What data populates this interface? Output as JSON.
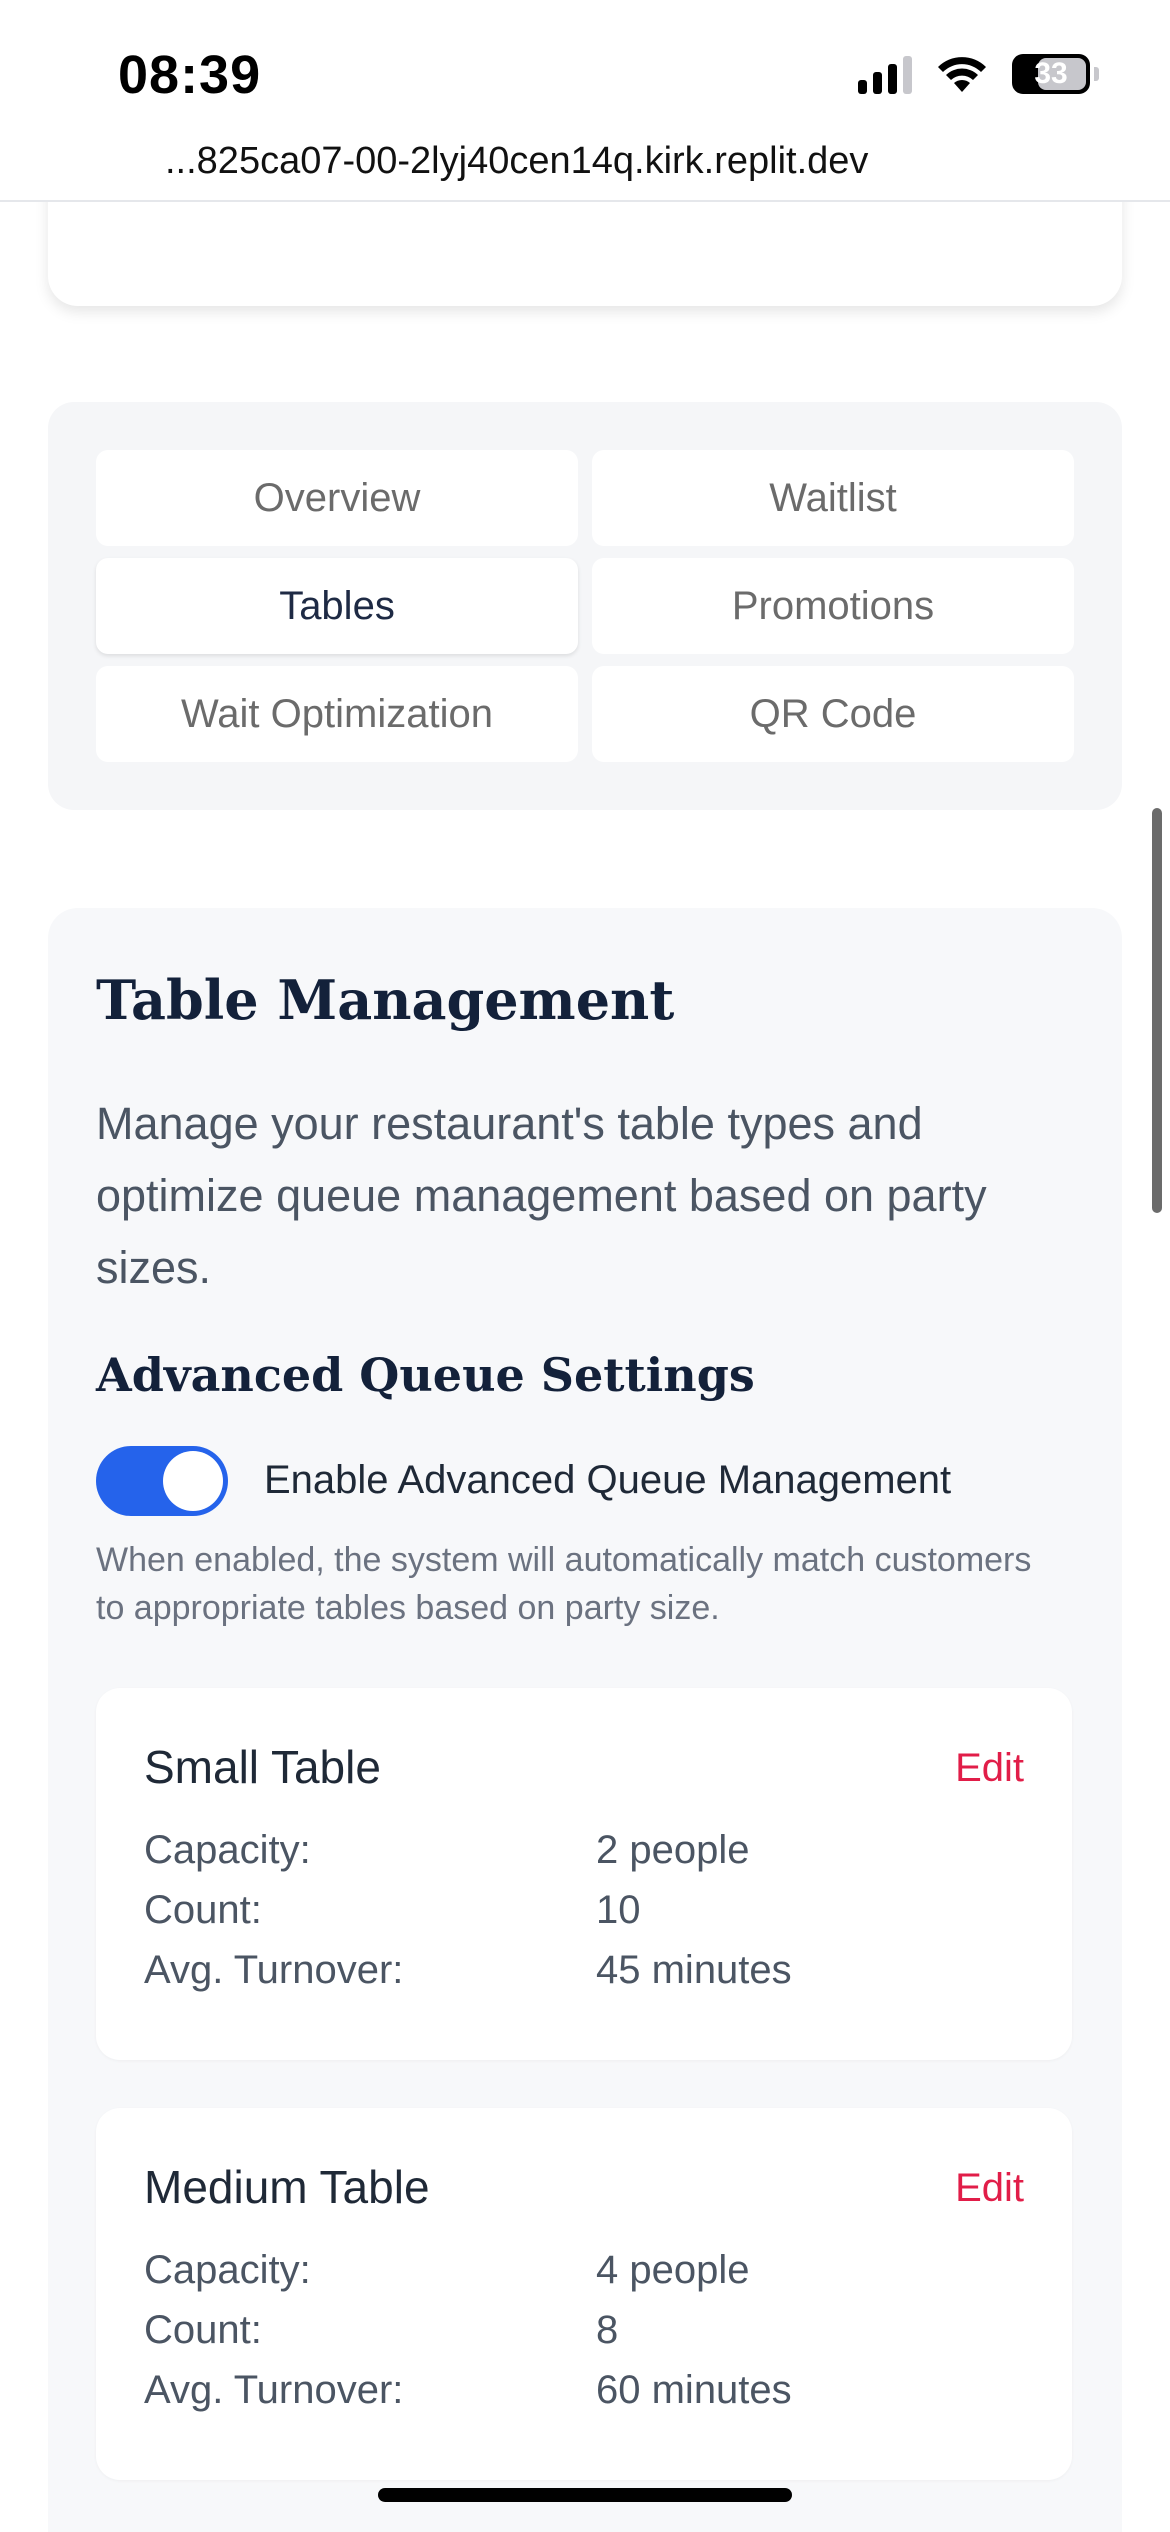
{
  "status_bar": {
    "time": "08:39",
    "battery": "33",
    "signal_icon": "cellular-signal-icon",
    "wifi_icon": "wifi-icon",
    "battery_icon": "battery-icon"
  },
  "browser": {
    "url": "...825ca07-00-2lyj40cen14q.kirk.replit.dev"
  },
  "tabs": [
    {
      "label": "Overview",
      "active": false
    },
    {
      "label": "Waitlist",
      "active": false
    },
    {
      "label": "Tables",
      "active": true
    },
    {
      "label": "Promotions",
      "active": false
    },
    {
      "label": "Wait Optimization",
      "active": false
    },
    {
      "label": "QR Code",
      "active": false
    }
  ],
  "table_management": {
    "title": "Table Management",
    "description": "Manage your restaurant's table types and optimize queue management based on party sizes.",
    "advanced": {
      "title": "Advanced Queue Settings",
      "toggle_label": "Enable Advanced Queue Management",
      "toggle_on": true,
      "help": "When enabled, the system will automatically match customers to appropriate tables based on party size."
    },
    "tables": [
      {
        "name": "Small Table",
        "edit_label": "Edit",
        "capacity_label": "Capacity:",
        "capacity": "2 people",
        "count_label": "Count:",
        "count": "10",
        "turnover_label": "Avg. Turnover:",
        "turnover": "45 minutes"
      },
      {
        "name": "Medium Table",
        "edit_label": "Edit",
        "capacity_label": "Capacity:",
        "capacity": "4 people",
        "count_label": "Count:",
        "count": "8",
        "turnover_label": "Avg. Turnover:",
        "turnover": "60 minutes"
      }
    ]
  },
  "colors": {
    "accent": "#2563eb",
    "edit": "#e11d48",
    "heading": "#13213a"
  }
}
